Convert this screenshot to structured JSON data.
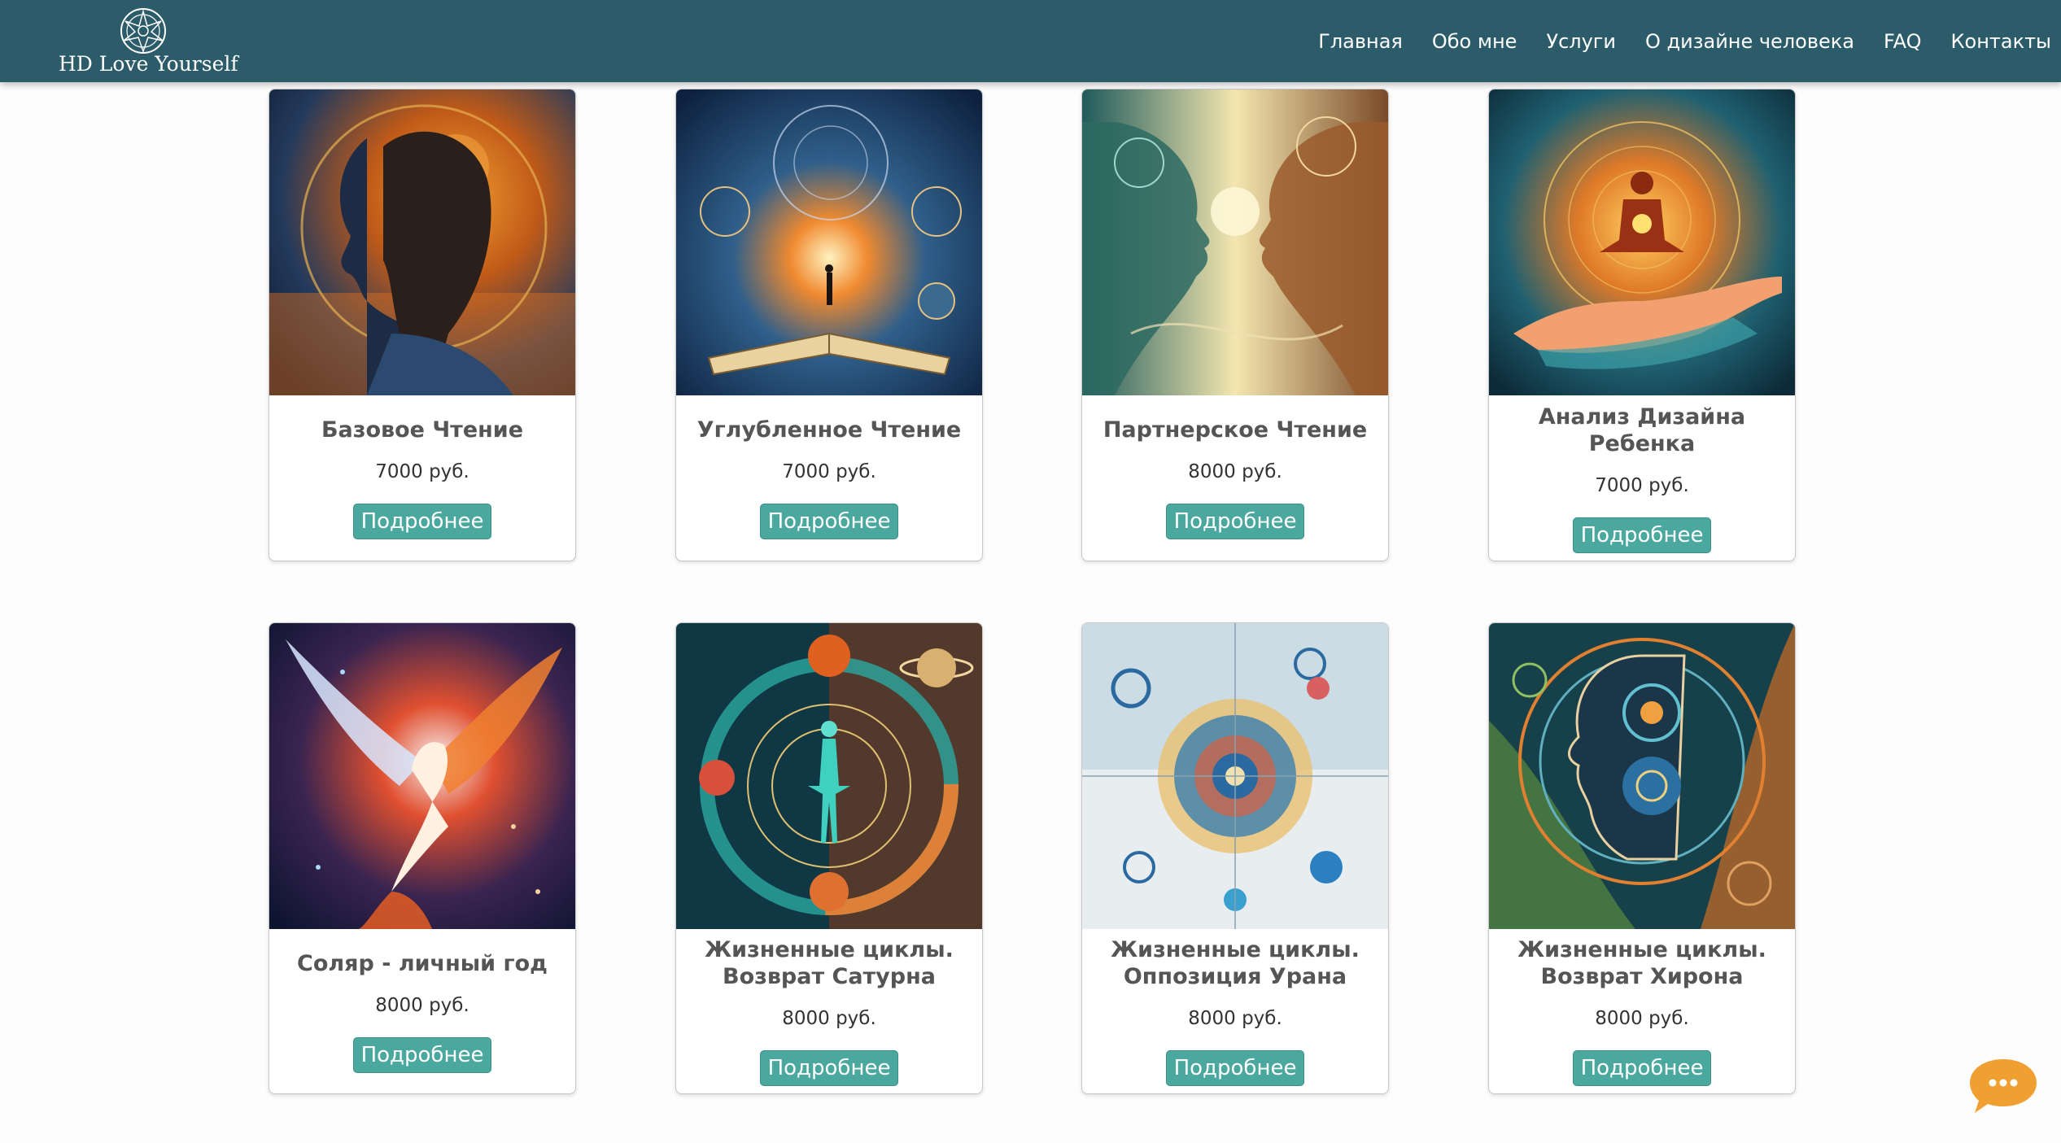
{
  "header": {
    "logo_text": "HD Love Yourself",
    "nav": [
      "Главная",
      "Обо мне",
      "Услуги",
      "О дизайне человека",
      "FAQ",
      "Контакты"
    ]
  },
  "cards": [
    {
      "title": "Базовое Чтение",
      "price": "7000 руб.",
      "button": "Подробнее",
      "image": "woman-profile-cosmic-sunset"
    },
    {
      "title": "Углубленное Чтение",
      "price": "7000 руб.",
      "button": "Подробнее",
      "image": "open-book-cosmic-mandala"
    },
    {
      "title": "Партнерское Чтение",
      "price": "8000 руб.",
      "button": "Подробнее",
      "image": "two-faces-facing-light"
    },
    {
      "title": "Анализ Дизайна Ребенка",
      "price": "7000 руб.",
      "button": "Подробнее",
      "image": "glowing-child-on-hand"
    },
    {
      "title": "Соляр - личный год",
      "price": "8000 руб.",
      "button": "Подробнее",
      "image": "fire-phoenix"
    },
    {
      "title": "Жизненные циклы. Возврат Сатурна",
      "price": "8000 руб.",
      "button": "Подробнее",
      "image": "human-figure-planets-orbits"
    },
    {
      "title": "Жизненные циклы. Оппозиция Урана",
      "price": "8000 руб.",
      "button": "Подробнее",
      "image": "geometric-circles-abstract"
    },
    {
      "title": "Жизненные циклы. Возврат Хирона",
      "price": "8000 руб.",
      "button": "Подробнее",
      "image": "head-silhouette-circles"
    }
  ],
  "colors": {
    "header_bg": "#2c5c6a",
    "button_bg": "#4aa89e",
    "chat_bg": "#f0a030"
  },
  "chat_icon": "chat-bubble-icon"
}
